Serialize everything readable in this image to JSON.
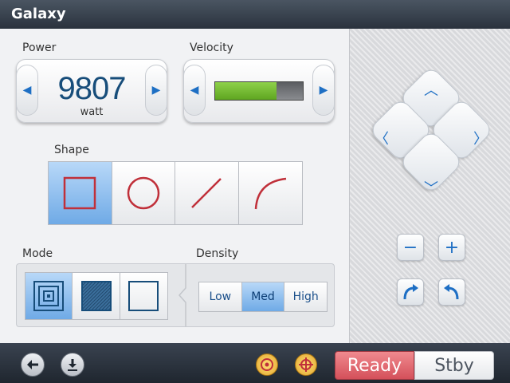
{
  "app": {
    "title": "Galaxy"
  },
  "power": {
    "label": "Power",
    "value": "9807",
    "unit": "watt"
  },
  "velocity": {
    "label": "Velocity",
    "level": 0.7
  },
  "shape": {
    "label": "Shape",
    "options": [
      {
        "icon": "square-icon",
        "selected": true
      },
      {
        "icon": "circle-icon",
        "selected": false
      },
      {
        "icon": "line-icon",
        "selected": false
      },
      {
        "icon": "arc-icon",
        "selected": false
      }
    ]
  },
  "mode": {
    "label": "Mode",
    "options": [
      {
        "icon": "concentric-squares-icon",
        "selected": true
      },
      {
        "icon": "hatched-square-icon",
        "selected": false
      },
      {
        "icon": "empty-square-icon",
        "selected": false
      }
    ]
  },
  "density": {
    "label": "Density",
    "options": [
      "Low",
      "Med",
      "High"
    ],
    "selected": "Med"
  },
  "status": {
    "ready": "Ready",
    "standby": "Stby"
  },
  "colors": {
    "accent": "#1e6fc4",
    "ready": "#d4505a",
    "velocity_bar": "#7cc23a"
  }
}
